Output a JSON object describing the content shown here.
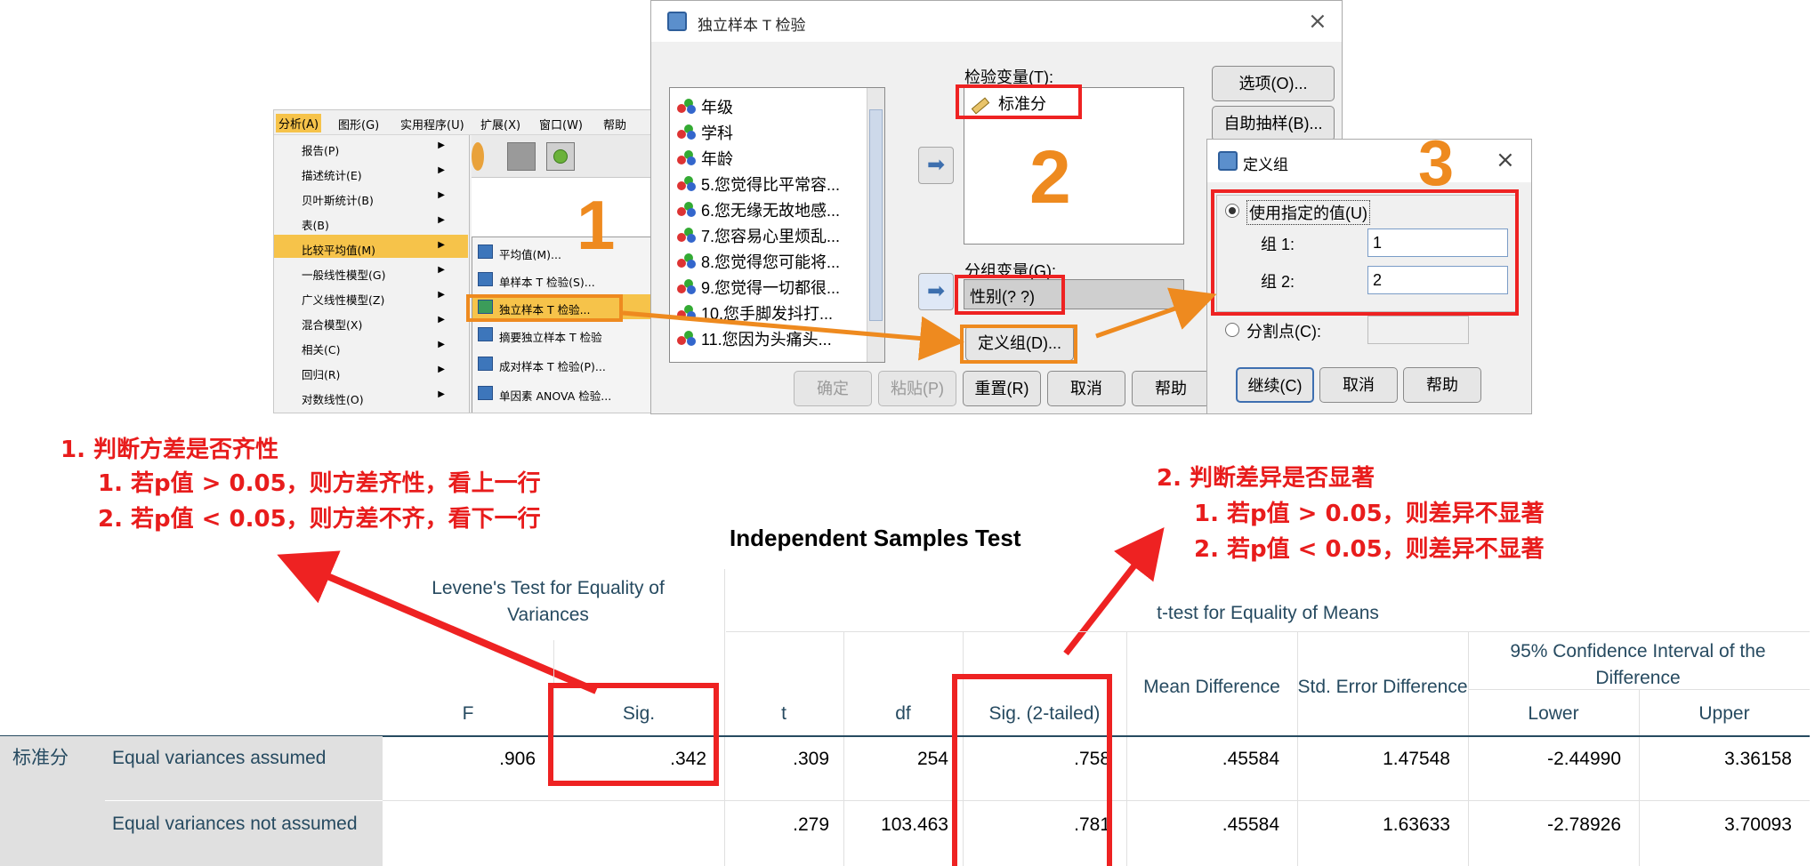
{
  "spss_menu": {
    "menubar": [
      "分析(A)",
      "图形(G)",
      "实用程序(U)",
      "扩展(X)",
      "窗口(W)",
      "帮助"
    ],
    "analyze_items": [
      {
        "label": "报告(P)"
      },
      {
        "label": "描述统计(E)"
      },
      {
        "label": "贝叶斯统计(B)"
      },
      {
        "label": "表(B)"
      },
      {
        "label": "比较平均值(M)"
      },
      {
        "label": "一般线性模型(G)"
      },
      {
        "label": "广义线性模型(Z)"
      },
      {
        "label": "混合模型(X)"
      },
      {
        "label": "相关(C)"
      },
      {
        "label": "回归(R)"
      },
      {
        "label": "对数线性(O)"
      }
    ],
    "submenu_items": [
      {
        "label": "平均值(M)..."
      },
      {
        "label": "单样本 T 检验(S)..."
      },
      {
        "label": "独立样本 T 检验..."
      },
      {
        "label": "摘要独立样本 T 检验"
      },
      {
        "label": "成对样本 T 检验(P)..."
      },
      {
        "label": "单因素 ANOVA 检验..."
      }
    ],
    "step_number": "1"
  },
  "t_dialog": {
    "title": "独立样本 T 检验",
    "close": "×",
    "variables": [
      "年级",
      "学科",
      "年龄",
      "5.您觉得比平常容...",
      "6.您无缘无故地感...",
      "7.您容易心里烦乱...",
      "8.您觉得您可能将...",
      "9.您觉得一切都很...",
      "10.您手脚发抖打...",
      "11.您因为头痛头..."
    ],
    "test_var_label": "检验变量(T):",
    "test_var_value": "标准分",
    "step_number_2": "2",
    "group_var_label": "分组变量(G):",
    "group_var_value": "性别(? ?)",
    "define_groups_btn": "定义组(D)...",
    "options_btn": "选项(O)...",
    "bootstrap_btn": "自助抽样(B)...",
    "ok_btn": "确定",
    "paste_btn": "粘贴(P)",
    "reset_btn": "重置(R)",
    "cancel_btn": "取消",
    "help_btn": "帮助"
  },
  "define_dialog": {
    "title": "定义组",
    "close": "×",
    "step_number": "3",
    "use_specified_label": "使用指定的值(U)",
    "group1_label": "组 1:",
    "group1_value": "1",
    "group2_label": "组 2:",
    "group2_value": "2",
    "cut_point_label": "分割点(C):",
    "continue_btn": "继续(C)",
    "cancel_btn": "取消",
    "help_btn": "帮助"
  },
  "annotations": {
    "left_title": "1. 判断方差是否齐性",
    "left_line1": "1. 若p值 > 0.05，则方差齐性，看上一行",
    "left_line2": "2. 若p值 < 0.05，则方差不齐，看下一行",
    "right_title": "2. 判断差异是否显著",
    "right_line1": "1. 若p值 > 0.05，则差异不显著",
    "right_line2": "2. 若p值 < 0.05，则差异不显著"
  },
  "table": {
    "title": "Independent Samples Test",
    "levene_header": "Levene's Test for Equality of Variances",
    "ttest_header": "t-test for Equality of Means",
    "ci_header": "95% Confidence Interval of the Difference",
    "columns": [
      "F",
      "Sig.",
      "t",
      "df",
      "Sig. (2-tailed)",
      "Mean Difference",
      "Std. Error Difference",
      "Lower",
      "Upper"
    ],
    "variable": "标准分",
    "rows": [
      {
        "label": "Equal variances assumed",
        "values": [
          ".906",
          ".342",
          ".309",
          "254",
          ".758",
          ".45584",
          "1.47548",
          "-2.44990",
          "3.36158"
        ]
      },
      {
        "label": "Equal variances not assumed",
        "values": [
          "",
          "",
          ".279",
          "103.463",
          ".781",
          ".45584",
          "1.63633",
          "-2.78926",
          "3.70093"
        ]
      }
    ]
  },
  "colors": {
    "annotation_red": "#e81c1c",
    "highlight_orange": "#ee8a1f",
    "menu_highlight": "#f6c34a",
    "table_header": "#264a60"
  }
}
